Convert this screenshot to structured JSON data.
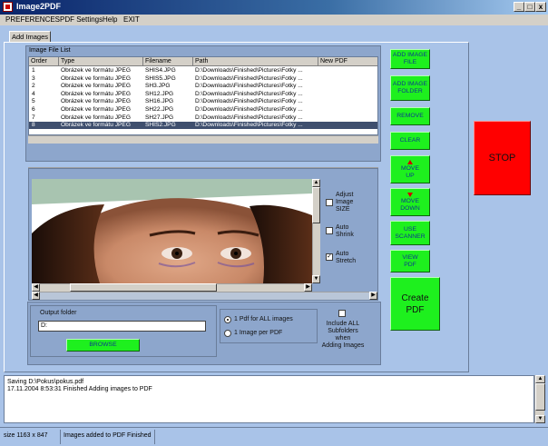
{
  "window": {
    "title": "Image2PDF",
    "min": "_",
    "max": "□",
    "close": "x"
  },
  "menu": [
    "PREFERENCES",
    "PDF Settings",
    "Help",
    "EXIT"
  ],
  "tab_label": "Add Images",
  "file_list": {
    "title": "Image File List",
    "columns": [
      "Order",
      "Type",
      "Filename",
      "Path",
      "New PDF"
    ],
    "rows": [
      {
        "order": "1",
        "type": "Obrázek ve formátu JPEG",
        "filename": "SHIS4.JPG",
        "path": "D:\\Downloads\\Finished\\Pictures\\Fotky ..."
      },
      {
        "order": "3",
        "type": "Obrázek ve formátu JPEG",
        "filename": "SHIS5.JPG",
        "path": "D:\\Downloads\\Finished\\Pictures\\Fotky ..."
      },
      {
        "order": "2",
        "type": "Obrázek ve formátu JPEG",
        "filename": "SH3.JPG",
        "path": "D:\\Downloads\\Finished\\Pictures\\Fotky ..."
      },
      {
        "order": "4",
        "type": "Obrázek ve formátu JPEG",
        "filename": "SH12.JPG",
        "path": "D:\\Downloads\\Finished\\Pictures\\Fotky ..."
      },
      {
        "order": "5",
        "type": "Obrázek ve formátu JPEG",
        "filename": "SH16.JPG",
        "path": "D:\\Downloads\\Finished\\Pictures\\Fotky ..."
      },
      {
        "order": "6",
        "type": "Obrázek ve formátu JPEG",
        "filename": "SH22.JPG",
        "path": "D:\\Downloads\\Finished\\Pictures\\Fotky ..."
      },
      {
        "order": "7",
        "type": "Obrázek ve formátu JPEG",
        "filename": "SH27.JPG",
        "path": "D:\\Downloads\\Finished\\Pictures\\Fotky ..."
      },
      {
        "order": "8",
        "type": "Obrázek ve formátu JPEG",
        "filename": "SHIS2.JPG",
        "path": "D:\\Downloads\\Finished\\Pictures\\Fotky ...",
        "selected": true
      }
    ]
  },
  "buttons": {
    "add_image_file": [
      "ADD IMAGE",
      "FILE"
    ],
    "add_image_folder": [
      "ADD IMAGE",
      "FOLDER"
    ],
    "remove": "REMOVE",
    "clear": "CLEAR",
    "move_up": [
      "MOVE",
      "UP"
    ],
    "move_down": [
      "MOVE",
      "DOWN"
    ],
    "use_scanner": [
      "USE",
      "SCANNER"
    ],
    "view_pdf": [
      "VIEW",
      "PDF"
    ],
    "create_pdf": [
      "Create",
      "PDF"
    ],
    "stop": "STOP",
    "browse": "BROWSE"
  },
  "preview_options": {
    "adjust": {
      "label": [
        "Adjust",
        "Image",
        "SIZE"
      ],
      "checked": false
    },
    "shrink": {
      "label": [
        "Auto",
        "Shrink"
      ],
      "checked": false
    },
    "stretch": {
      "label": [
        "Auto",
        "Stretch"
      ],
      "checked": true
    }
  },
  "output": {
    "title": "Output folder",
    "value": "D:",
    "radio_all": "1 Pdf for ALL images",
    "radio_each": "1 Image per PDF",
    "radio_selected": "all",
    "include_sub": [
      "Include ALL",
      "Subfolders when",
      "Adding Images"
    ],
    "include_sub_checked": false
  },
  "log_lines": [
    "Saving D:\\Pokus\\pokus.pdf",
    "17.11.2004 8:53:31 Finished Adding images to PDF"
  ],
  "status": {
    "size": "size 1163  x  847",
    "message": "Images added to PDF Finished"
  },
  "colors": {
    "green_button": "#1ef01e",
    "stop_button": "#ff0000",
    "selection": "#3f4f6e",
    "background": "#a9c3e8"
  }
}
